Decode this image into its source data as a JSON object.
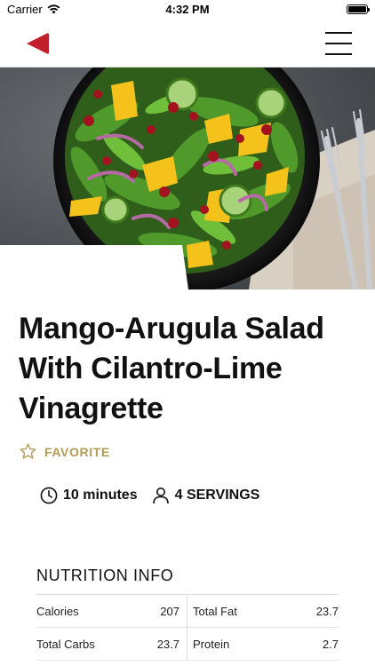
{
  "status_bar": {
    "carrier": "Carrier",
    "time": "4:32 PM"
  },
  "nav": {
    "back_icon": "back-triangle-icon",
    "menu_icon": "hamburger-menu-icon",
    "accent_color": "#c2212c"
  },
  "hero": {
    "image": "mango-arugula-salad-photo"
  },
  "recipe": {
    "title": "Mango-Arugula Salad With Cilantro-Lime Vinagrette",
    "favorite_label": "FAVORITE",
    "favorite_color": "#b79a55",
    "time": "10 minutes",
    "servings": "4 SERVINGS"
  },
  "nutrition": {
    "title": "NUTRITION INFO",
    "rows": [
      {
        "left_label": "Calories",
        "left_value": "207",
        "right_label": "Total Fat",
        "right_value": "23.7"
      },
      {
        "left_label": "Total Carbs",
        "left_value": "23.7",
        "right_label": "Protein",
        "right_value": "2.7"
      }
    ]
  }
}
